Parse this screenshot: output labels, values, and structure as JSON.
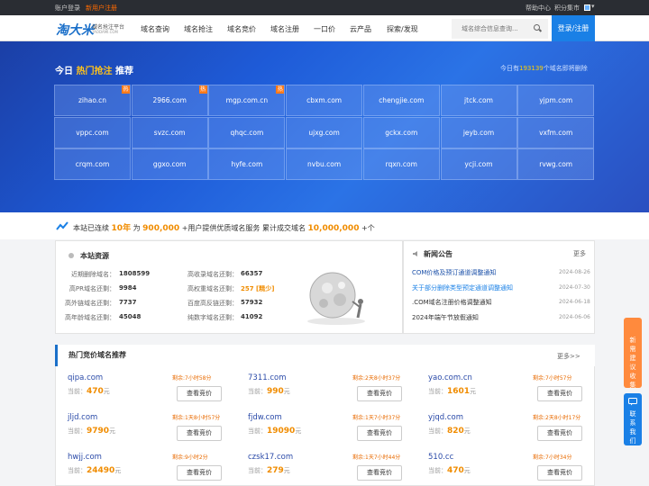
{
  "topbar": {
    "login": "账户登录",
    "register": "新用户注册",
    "help": "帮助中心",
    "points": "积分集市"
  },
  "header": {
    "logo": "淘大米",
    "logo_sub": "域名抢注平台",
    "logo_sub2": "TAODAMI.COM",
    "nav": [
      "域名查询",
      "域名抢注",
      "域名竞价",
      "域名注册",
      "一口价",
      "云产品",
      "探索/发现"
    ],
    "search_placeholder": "域名综合信息查询...",
    "login_btn": "登录/注册"
  },
  "hero": {
    "title_prefix": "今日",
    "title_highlight": "热门抢注",
    "title_suffix": "推荐",
    "count_prefix": "今日有",
    "count_value": "193139",
    "count_suffix": "个域名即将删除",
    "domains": [
      {
        "name": "zihao.cn",
        "hot": true
      },
      {
        "name": "2966.com",
        "hot": true
      },
      {
        "name": "mgp.com.cn",
        "hot": true
      },
      {
        "name": "cbxm.com",
        "hot": false
      },
      {
        "name": "chengjie.com",
        "hot": false
      },
      {
        "name": "jtck.com",
        "hot": false
      },
      {
        "name": "yjpm.com",
        "hot": false
      },
      {
        "name": "vppc.com",
        "hot": false
      },
      {
        "name": "svzc.com",
        "hot": false
      },
      {
        "name": "qhqc.com",
        "hot": false
      },
      {
        "name": "ujxg.com",
        "hot": false
      },
      {
        "name": "gckx.com",
        "hot": false
      },
      {
        "name": "jeyb.com",
        "hot": false
      },
      {
        "name": "vxfm.com",
        "hot": false
      },
      {
        "name": "crqm.com",
        "hot": false
      },
      {
        "name": "ggxo.com",
        "hot": false
      },
      {
        "name": "hyfe.com",
        "hot": false
      },
      {
        "name": "nvbu.com",
        "hot": false
      },
      {
        "name": "rqxn.com",
        "hot": false
      },
      {
        "name": "ycji.com",
        "hot": false
      },
      {
        "name": "rvwg.com",
        "hot": false
      }
    ],
    "hot_badge": "热"
  },
  "stripe": {
    "t1": "本站已连续",
    "years": "10年",
    "t2": "为",
    "users": "900,000",
    "t3": "+用户提供优质域名服务  累计成交域名",
    "deals": "10,000,000",
    "t4": "+个"
  },
  "resources": {
    "title": "本站资源",
    "left": [
      {
        "label": "近期删除域名：",
        "value": "1808599"
      },
      {
        "label": "高PR域名还剩：",
        "value": "9984"
      },
      {
        "label": "高外链域名还剩：",
        "value": "7737"
      },
      {
        "label": "高年龄域名还剩：",
        "value": "45048"
      }
    ],
    "right": [
      {
        "label": "高收录域名还剩：",
        "value": "66357"
      },
      {
        "label": "高权重域名还剩：",
        "value": "257 [精少]"
      },
      {
        "label": "百度高反链还剩：",
        "value": "57932"
      },
      {
        "label": "纯数字域名还剩：",
        "value": "41092"
      }
    ]
  },
  "news": {
    "title": "新闻公告",
    "more": "更多",
    "items": [
      {
        "text": "COM价格及预订通道调整通知",
        "date": "2024-08-26",
        "color": "#1a4fa8"
      },
      {
        "text": "关于部分删除类型预定通道调整通知",
        "date": "2024-07-30",
        "color": "#1a80e6"
      },
      {
        "text": ".COM域名注册价格调整通知",
        "date": "2024-06-18",
        "color": "#333333"
      },
      {
        "text": "2024年端午节放假通知",
        "date": "2024-06-06",
        "color": "#333333"
      }
    ]
  },
  "auction": {
    "title": "热门竞价域名推荐",
    "more": "更多>>",
    "price_prefix": "当前：",
    "price_unit": "元",
    "button": "查看竞价",
    "items": [
      {
        "domain": "qipa.com",
        "time": "剩余:7小时58分",
        "price": "470"
      },
      {
        "domain": "7311.com",
        "time": "剩余:2天8小时37分",
        "price": "990"
      },
      {
        "domain": "yao.com.cn",
        "time": "剩余:7小时57分",
        "price": "1601"
      },
      {
        "domain": "jljd.com",
        "time": "剩余:1天8小时57分",
        "price": "9790"
      },
      {
        "domain": "fjdw.com",
        "time": "剩余:1天7小时37分",
        "price": "19090"
      },
      {
        "domain": "yjqd.com",
        "time": "剩余:2天8小时17分",
        "price": "820"
      },
      {
        "domain": "hwjj.com",
        "time": "剩余:9小时2分",
        "price": "24490"
      },
      {
        "domain": "czsk17.com",
        "time": "剩余:1天7小时44分",
        "price": "279"
      },
      {
        "domain": "510.cc",
        "time": "剩余:7小时34分",
        "price": "470"
      }
    ]
  },
  "side": {
    "feedback": "新需建议收集",
    "contact": "联系我们"
  }
}
